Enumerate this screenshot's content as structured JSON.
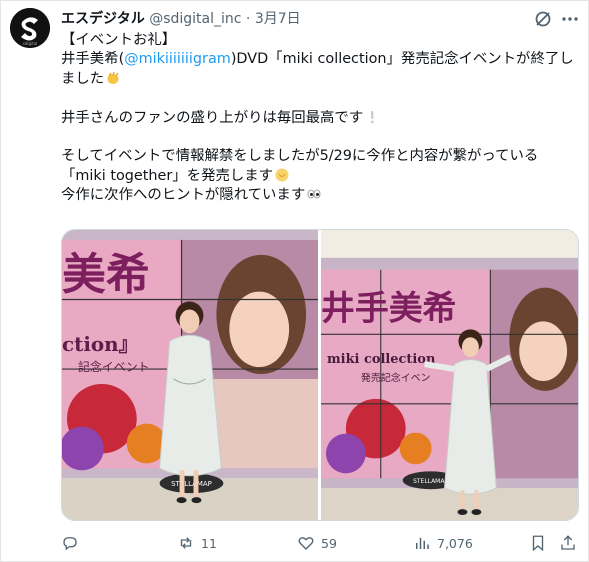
{
  "author": {
    "name": "エスデジタル",
    "handle": "@sdigital_inc",
    "separator": "·",
    "date": "3月7日",
    "avatar_icon": "sdigital-logo-icon",
    "avatar_caption": "sdigital"
  },
  "body": {
    "line1": "【イベントお礼】",
    "line2_prefix": "井手美希(",
    "line2_mention": "@mikiiiiiiigram",
    "line2_suffix": ")DVD「miki collection」発売記念イベントが終了し",
    "line3": "ました",
    "line4": "井手さんのファンの盛り上がりは毎回最高です",
    "line5": "そしてイベントで情報解禁をしましたが5/29に今作と内容が繋がっている",
    "line6": "「miki together」を発売します",
    "line7": "今作に次作へのヒントが隠れています"
  },
  "media": {
    "photo1": {
      "poster_big_text": "美希",
      "poster_sub_text": "ction』",
      "poster_small_text": "記念イベント",
      "floor_sign": "STELLAMAP"
    },
    "photo2": {
      "poster_big_text": "井手美希",
      "poster_sub_text": "miki collection",
      "poster_small_text": "発売記念イベン",
      "floor_sign": "STELLAMAP"
    }
  },
  "actions": {
    "reply_count": "",
    "retweet_count": "11",
    "like_count": "59",
    "views_count": "7,076"
  },
  "colors": {
    "text": "#0f1419",
    "secondary": "#536471",
    "link": "#1d9bf0",
    "border": "#cfd9de"
  }
}
